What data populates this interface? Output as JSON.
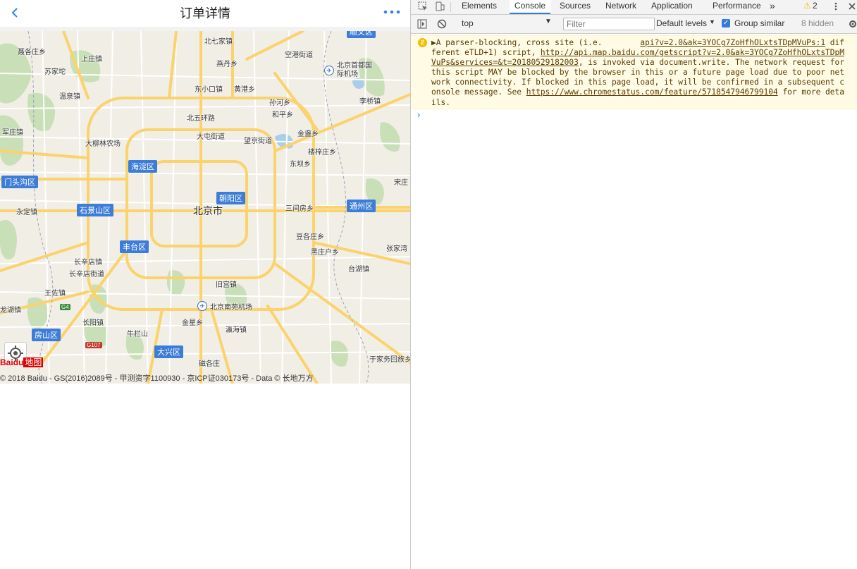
{
  "mobile": {
    "header": {
      "title": "订单详情",
      "back_icon": "chevron-left-icon",
      "more_icon": "more-dots-icon"
    },
    "map": {
      "city_label": "北京市",
      "districts": [
        "海淀区",
        "朝阳区",
        "门头沟区",
        "石景山区",
        "丰台区",
        "通州区",
        "房山区",
        "大兴区",
        "顺义区"
      ],
      "place_labels": [
        "聂各庄乡",
        "上庄镇",
        "北七家镇",
        "空港街道",
        "苏家坨",
        "燕丹乡",
        "北京首都国际机场",
        "温泉镇",
        "东小口镇",
        "黄港乡",
        "李桥镇",
        "孙河乡",
        "北五环路",
        "和平乡",
        "军庄镇",
        "大屯街道",
        "金盏乡",
        "大柳林农场",
        "望京街道",
        "楼梓庄乡",
        "东坝乡",
        "宋庄",
        "永定镇",
        "三间房乡",
        "豆各庄乡",
        "黑庄户乡",
        "张家湾",
        "长辛店镇",
        "长辛店街道",
        "台湖镇",
        "王佐镇",
        "旧宫镇",
        "北京南苑机场",
        "龙湖镇",
        "金星乡",
        "长阳镇",
        "瀛海镇",
        "牛栏山",
        "磁各庄",
        "于家务回族乡"
      ],
      "road_shields": [
        "G4",
        "G107"
      ],
      "logo_text": "Baidu",
      "logo_map_text": "地图",
      "copyright": "© 2018 Baidu - GS(2016)2089号 - 甲测资字1100930 - 京ICP证030173号 - Data © 长地万方"
    }
  },
  "devtools": {
    "tabs": [
      "Elements",
      "Console",
      "Sources",
      "Network",
      "Application",
      "Performance"
    ],
    "active_tab": "Console",
    "overflow_label": "»",
    "warning_count": "2",
    "context": "top",
    "filter_placeholder": "Filter",
    "levels": "Default levels",
    "group_similar": "Group similar",
    "hidden_count": "8 hidden",
    "message": {
      "count": "2",
      "prefix": "▶A parser-blocking, cross site (i.e.        ",
      "link1": "api?v=2.0&ak=3YOCg7ZoHfhOLxtsTDpMVuPs:1",
      "mid": " different eTLD+1) script, ",
      "link2": "http://api.map.baidu.com/getscript?v=2.0&ak=3YOCg7ZoHfhOLxtsTDpMVuPs&services=&t=20180529182003",
      "mid2": ", is invoked via document.write. The network request for this script MAY be blocked by the browser in this or a future page load due to poor network connectivity. If blocked in this page load, it will be confirmed in a subsequent console message. See ",
      "link3": "https://www.chromestatus.com/feature/5718547946799104",
      "suffix": " for more details."
    },
    "prompt": "›",
    "colors": {
      "accent": "#3879d9",
      "warning_bg": "#fffbe5",
      "warning_badge": "#f4bd00"
    }
  }
}
